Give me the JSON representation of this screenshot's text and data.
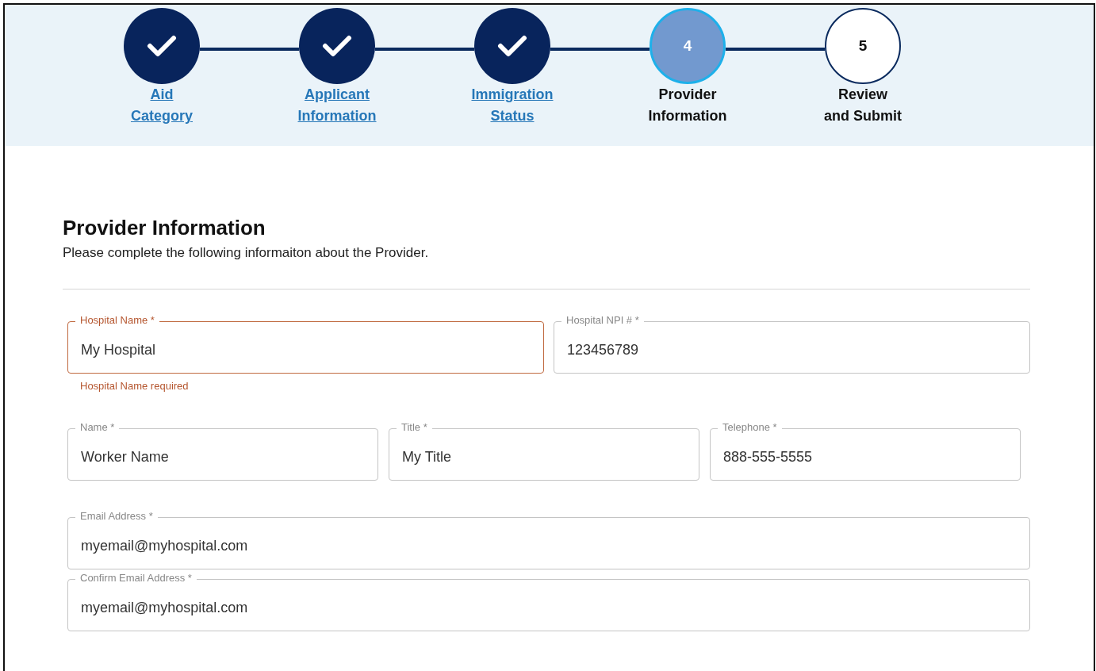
{
  "steps": [
    {
      "label": "Aid\nCategory",
      "kind": "done"
    },
    {
      "label": "Applicant\nInformation",
      "kind": "done"
    },
    {
      "label": "Immigration\nStatus",
      "kind": "done"
    },
    {
      "number": "4",
      "label": "Provider\nInformation",
      "kind": "current"
    },
    {
      "number": "5",
      "label": "Review\nand Submit",
      "kind": "upcoming"
    }
  ],
  "section": {
    "title": "Provider Information",
    "description": "Please complete the following informaiton about the Provider."
  },
  "field_rows": [
    {
      "fields": [
        {
          "label": "Hospital Name *",
          "value": "My Hospital",
          "error": true,
          "error_message": "Hospital Name required"
        },
        {
          "label": "Hospital NPI # *",
          "value": "123456789",
          "error": false
        }
      ]
    },
    {
      "fields": [
        {
          "label": "Name *",
          "value": "Worker Name",
          "error": false
        },
        {
          "label": "Title *",
          "value": "My Title",
          "error": false
        },
        {
          "label": "Telephone *",
          "value": "888-555-5555",
          "error": false
        }
      ]
    },
    {
      "fields": [
        {
          "label": "Email Address *",
          "value": "myemail@myhospital.com",
          "error": false
        }
      ]
    },
    {
      "fields": [
        {
          "label": "Confirm Email Address *",
          "value": "myemail@myhospital.com",
          "error": false
        }
      ]
    }
  ]
}
